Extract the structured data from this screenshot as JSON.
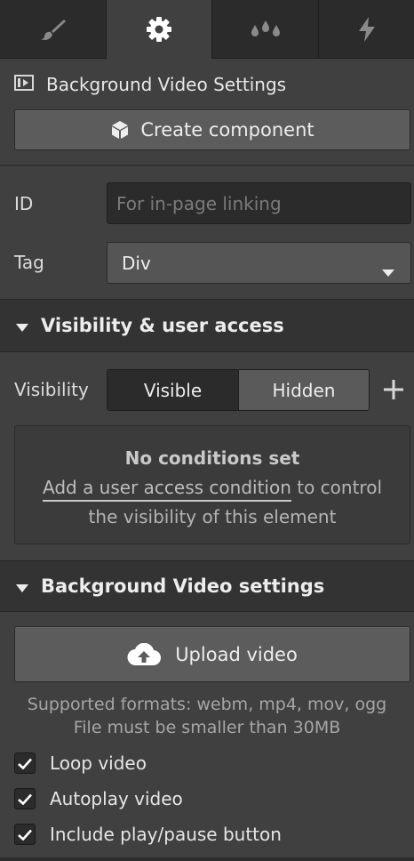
{
  "tabs": [
    {
      "icon": "brush-icon",
      "active": false
    },
    {
      "icon": "gear-icon",
      "active": true
    },
    {
      "icon": "drops-icon",
      "active": false
    },
    {
      "icon": "lightning-icon",
      "active": false
    }
  ],
  "element": {
    "title": "Background Video Settings",
    "create_component_label": "Create component"
  },
  "fields": {
    "id_label": "ID",
    "id_placeholder": "For in-page linking",
    "id_value": "",
    "tag_label": "Tag",
    "tag_value": "Div"
  },
  "visibility": {
    "header": "Visibility & user access",
    "label": "Visibility",
    "options": [
      "Visible",
      "Hidden"
    ],
    "selected": "Visible",
    "conditions_title": "No conditions set",
    "conditions_link": "Add a user access condition",
    "conditions_text_after_link": "to control",
    "conditions_text_line2": "the visibility of this element"
  },
  "video": {
    "header": "Background Video settings",
    "upload_label": "Upload video",
    "formats_text": "Supported formats: webm, mp4, mov, ogg",
    "size_text": "File must be smaller than 30MB",
    "options": [
      {
        "label": "Loop video",
        "checked": true
      },
      {
        "label": "Autoplay video",
        "checked": true
      },
      {
        "label": "Include play/pause button",
        "checked": true
      }
    ]
  },
  "colors": {
    "panel_bg": "#404040",
    "tabbar_bg": "#2b2b2b",
    "section_header_bg": "#333333",
    "button_bg": "#5c5c5c",
    "input_bg": "#2b2b2b"
  }
}
